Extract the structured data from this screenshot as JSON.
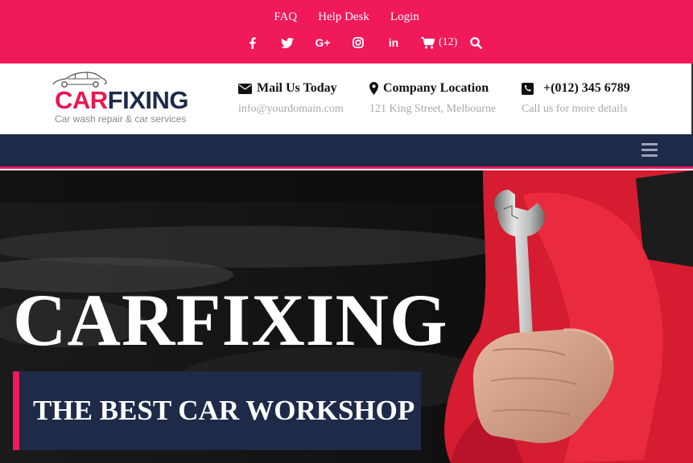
{
  "topbar": {
    "links": [
      "FAQ",
      "Help Desk",
      "Login"
    ],
    "socials": [
      "facebook-icon",
      "twitter-icon",
      "google-plus-icon",
      "instagram-icon",
      "linkedin-icon"
    ],
    "cart_count": "(12)",
    "colors": {
      "accent": "#f0195a"
    }
  },
  "header": {
    "logo": {
      "word1": "CAR",
      "word2": "FIXING",
      "tagline": "Car wash repair & car services"
    },
    "mail": {
      "title": "Mail Us Today",
      "detail": "info@yourdomain.com"
    },
    "location": {
      "title": "Company Location",
      "detail": "121 King Street, Melbourne"
    },
    "phone": {
      "title": "+(012) 345 6789",
      "detail": "Call us for more details"
    }
  },
  "nav": {
    "menu_icon": "hamburger-icon",
    "color": "#1e2a48"
  },
  "hero": {
    "title": "CARFIXING",
    "subtitle": "THE BEST CAR WORKSHOP"
  }
}
